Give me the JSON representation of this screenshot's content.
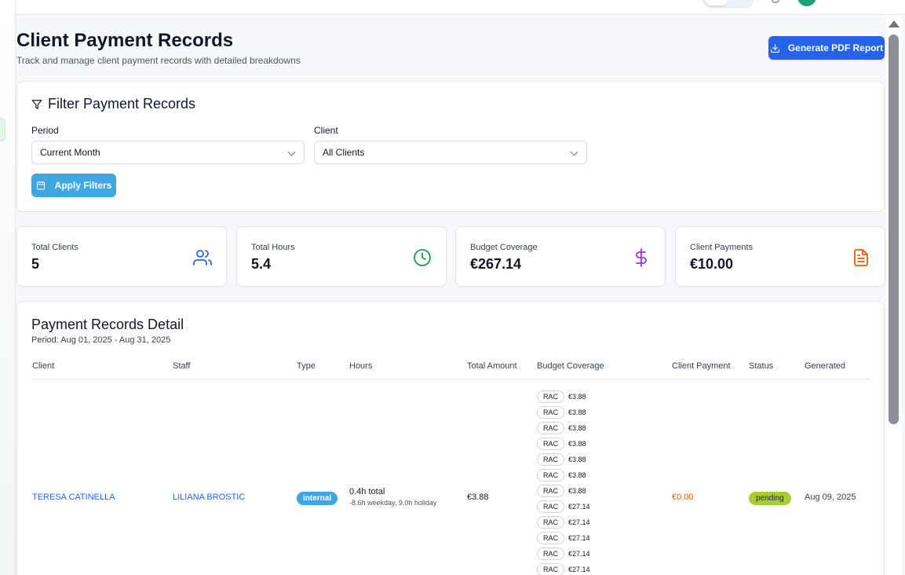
{
  "colors": {
    "primary": "#2563eb",
    "apply": "#3ea7e3",
    "users_icon": "#2563eb",
    "clock_icon": "#16a34a",
    "dollar_icon": "#9333ea",
    "file_icon": "#ea580c",
    "client_payment": "#ea580c",
    "status_pending": "#a8cc31"
  },
  "header": {
    "title": "Client Payment Records",
    "subtitle": "Track and manage client payment records with detailed breakdowns",
    "pdf_button": "Generate PDF Report",
    "pdf_icon": "download-icon"
  },
  "filters": {
    "title": "Filter Payment Records",
    "title_icon": "filter-icon",
    "period_label": "Period",
    "period_value": "Current Month",
    "client_label": "Client",
    "client_value": "All Clients",
    "apply_button": "Apply Filters",
    "apply_icon": "calendar-icon"
  },
  "stats": [
    {
      "label": "Total Clients",
      "value": "5",
      "icon": "users-icon"
    },
    {
      "label": "Total Hours",
      "value": "5.4",
      "icon": "clock-icon"
    },
    {
      "label": "Budget Coverage",
      "value": "€267.14",
      "icon": "dollar-icon"
    },
    {
      "label": "Client Payments",
      "value": "€10.00",
      "icon": "file-text-icon"
    }
  ],
  "detail": {
    "title": "Payment Records Detail",
    "period": "Period: Aug 01, 2025 - Aug 31, 2025",
    "columns": [
      "Client",
      "Staff",
      "Type",
      "Hours",
      "Total Amount",
      "Budget Coverage",
      "Client Payment",
      "Status",
      "Generated"
    ],
    "row": {
      "client": "TERESA CATINELLA",
      "staff": "LILIANA BROSTIC",
      "type": "internal",
      "hours_total": "0.4h total",
      "hours_breakdown": "-8.6h weekday, 9.0h holiday",
      "total_amount": "€3.88",
      "client_payment": "€0.00",
      "status": "pending",
      "generated": "Aug 09, 2025",
      "coverage": [
        {
          "tag": "RAC",
          "amount": "€3.88"
        },
        {
          "tag": "RAC",
          "amount": "€3.88"
        },
        {
          "tag": "RAC",
          "amount": "€3.88"
        },
        {
          "tag": "RAC",
          "amount": "€3.88"
        },
        {
          "tag": "RAC",
          "amount": "€3.88"
        },
        {
          "tag": "RAC",
          "amount": "€3.88"
        },
        {
          "tag": "RAC",
          "amount": "€3.88"
        },
        {
          "tag": "RAC",
          "amount": "€27.14"
        },
        {
          "tag": "RAC",
          "amount": "€27.14"
        },
        {
          "tag": "RAC",
          "amount": "€27.14"
        },
        {
          "tag": "RAC",
          "amount": "€27.14"
        },
        {
          "tag": "RAC",
          "amount": "€27.14"
        }
      ]
    }
  }
}
